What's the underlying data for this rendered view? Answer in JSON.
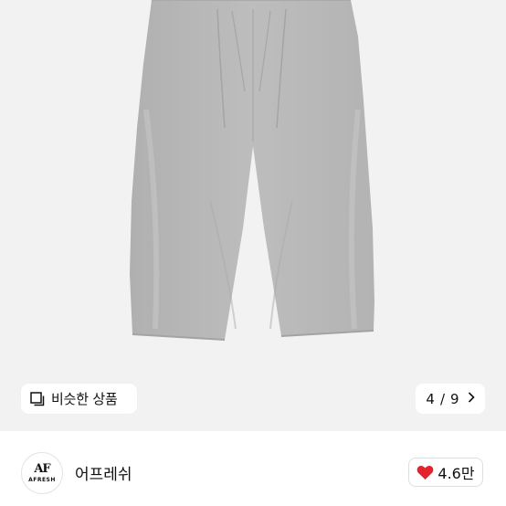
{
  "product": {
    "image_alt": "gray wide pleated pants",
    "similar_button": {
      "label": "비슷한 상품",
      "icon": "copy-icon"
    },
    "image_counter": {
      "current": "4",
      "separator": "/",
      "total": "9",
      "icon": "chevron-right-icon"
    }
  },
  "brand": {
    "logo_mark": "AF",
    "logo_text": "AFRESH",
    "name": "어프레쉬",
    "like": {
      "count": "4.6만",
      "icon": "heart-icon",
      "color": "#e5232c"
    }
  },
  "colors": {
    "image_bg": "#f2f2f3",
    "pants_fabric": "#b9b9b9",
    "heart": "#e5232c"
  }
}
